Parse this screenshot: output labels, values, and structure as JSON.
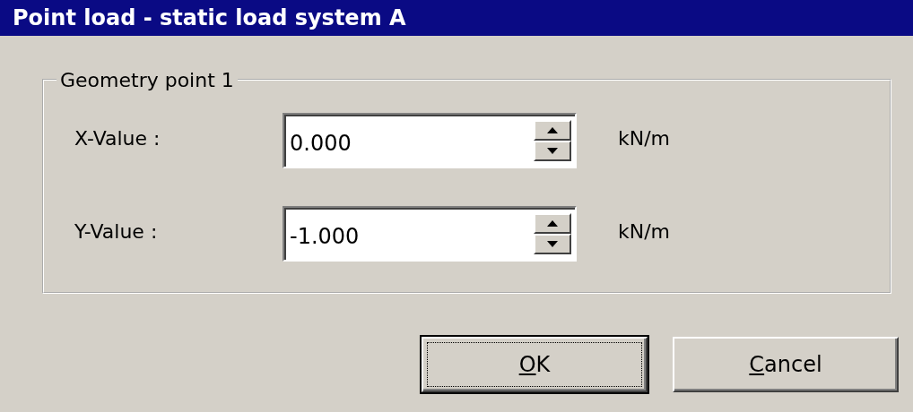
{
  "window": {
    "title": "Point load - static load system A"
  },
  "group": {
    "title": "Geometry point 1",
    "fields": [
      {
        "label": "X-Value :",
        "value": "0.000",
        "unit": "kN/m"
      },
      {
        "label": "Y-Value :",
        "value": "-1.000",
        "unit": "kN/m"
      }
    ]
  },
  "buttons": [
    {
      "label": "OK",
      "first_letter_underlined": true,
      "focused": true
    },
    {
      "label": "Cancel",
      "first_letter_underlined": true,
      "focused": false
    }
  ]
}
